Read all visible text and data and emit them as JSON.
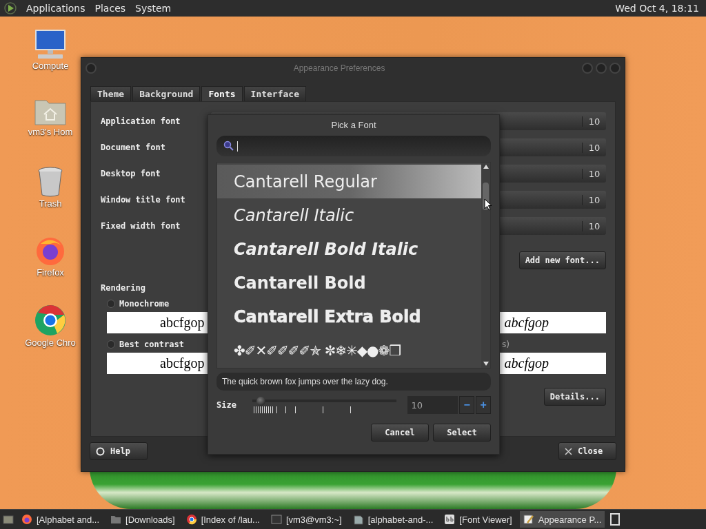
{
  "top_panel": {
    "menus": [
      "Applications",
      "Places",
      "System"
    ],
    "clock": "Wed Oct 4, 18:11"
  },
  "desktop_icons": [
    {
      "kind": "computer",
      "label": "Compute"
    },
    {
      "kind": "home",
      "label": "vm3's Hom"
    },
    {
      "kind": "trash",
      "label": "Trash"
    },
    {
      "kind": "firefox",
      "label": "Firefox"
    },
    {
      "kind": "chrome",
      "label": "Google Chro"
    }
  ],
  "appearance_window": {
    "title": "Appearance Preferences",
    "tabs": [
      {
        "label": "Theme",
        "selected": false
      },
      {
        "label": "Background",
        "selected": false
      },
      {
        "label": "Fonts",
        "selected": true
      },
      {
        "label": "Interface",
        "selected": false
      }
    ],
    "font_rows": [
      {
        "label": "Application font",
        "size": "10"
      },
      {
        "label": "Document font",
        "size": "10"
      },
      {
        "label": "Desktop font",
        "size": "10"
      },
      {
        "label": "Window title font",
        "size": "10"
      },
      {
        "label": "Fixed width font",
        "size": "10"
      }
    ],
    "add_button": "Add new font...",
    "rendering_title": "Rendering",
    "rendering_options": [
      {
        "label": "Monochrome",
        "selected": false,
        "sample_left": "abcfgop",
        "sample_right": "abcfgop"
      },
      {
        "label": "Best contrast",
        "selected": false,
        "note": "s)",
        "sample_left": "abcfgop",
        "sample_right": "abcfgop"
      }
    ],
    "details_button": "Details...",
    "help_button": "Help",
    "close_button": "Close"
  },
  "font_dialog": {
    "title": "Pick a Font",
    "fonts": [
      {
        "name": "Cantarell Regular",
        "kind": "regular",
        "selected": true
      },
      {
        "name": "Cantarell Italic",
        "kind": "italic",
        "selected": false
      },
      {
        "name": "Cantarell Bold Italic",
        "kind": "bold-italic",
        "selected": false
      },
      {
        "name": "Cantarell Bold",
        "kind": "bold",
        "selected": false
      },
      {
        "name": "Cantarell Extra Bold",
        "kind": "extra-bold",
        "selected": false
      },
      {
        "name": "✤✐✕✐✐✐✐✯ ✼❄✳◆●❁❒",
        "kind": "symbol",
        "selected": false
      }
    ],
    "preview": "The quick brown fox jumps over the lazy dog.",
    "size_label": "Size",
    "size_slider": {
      "level": 0.03
    },
    "size_value": "10",
    "minus": "−",
    "plus": "+",
    "buttons": [
      "Cancel",
      "Select"
    ]
  },
  "taskbar": [
    {
      "kind": "firefox",
      "label": "[Alphabet and...",
      "selected": false
    },
    {
      "kind": "folder",
      "label": "[Downloads]",
      "selected": false
    },
    {
      "kind": "chrome",
      "label": "[Index of /lau...",
      "selected": false
    },
    {
      "kind": "terminal",
      "label": "[vm3@vm3:~]",
      "selected": false
    },
    {
      "kind": "document",
      "label": "[alphabet-and-...",
      "selected": false
    },
    {
      "kind": "fontviewer",
      "label": "[Font Viewer]",
      "selected": false
    },
    {
      "kind": "appearance",
      "label": "Appearance P...",
      "selected": true
    }
  ]
}
